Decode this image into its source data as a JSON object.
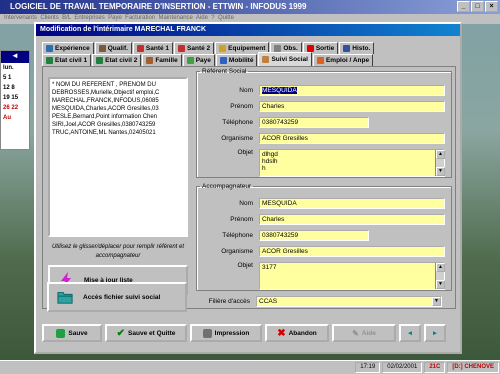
{
  "background_app": {
    "title": "LOGICIEL DE TRAVAIL TEMPORAIRE D'INSERTION - ETTWIN - INFODUS 1999",
    "menu_items": [
      "Intervenants",
      "Clients",
      "B/L",
      "Entreprises",
      "Paye",
      "Facturation",
      "Maintenance",
      "Aide",
      "?",
      "Quitte"
    ],
    "left_panel": {
      "header": "lun.",
      "days": [
        "5",
        "12",
        "19",
        "26"
      ],
      "other": [
        "1",
        "8",
        "15",
        "22"
      ],
      "label": "Au"
    },
    "status": {
      "time": "17:19",
      "date": "02/02/2001",
      "code": "21C",
      "drive": "[D:] CHENOVE"
    }
  },
  "dialog": {
    "title": "Modification de l'intérimaire MARECHAL FRANCK",
    "tabs_row1": [
      {
        "label": "Expérience",
        "icon": "book-icon"
      },
      {
        "label": "Qualif.",
        "icon": "tools-icon"
      },
      {
        "label": "Santé 1",
        "icon": "health-icon"
      },
      {
        "label": "Santé 2",
        "icon": "health-icon"
      },
      {
        "label": "Equipement",
        "icon": "helmet-icon"
      },
      {
        "label": "Obs.",
        "icon": "note-icon"
      },
      {
        "label": "Sortie",
        "icon": "exit-icon"
      },
      {
        "label": "Histo.",
        "icon": "history-icon"
      }
    ],
    "tabs_row2": [
      {
        "label": "Etat civil 1",
        "icon": "id-icon"
      },
      {
        "label": "Etat civil 2",
        "icon": "id-icon"
      },
      {
        "label": "Famille",
        "icon": "family-icon"
      },
      {
        "label": "Paye",
        "icon": "money-icon"
      },
      {
        "label": "Mobilité",
        "icon": "car-icon"
      },
      {
        "label": "Suivi Social",
        "icon": "social-icon",
        "active": true
      },
      {
        "label": "Emploi / Anpe",
        "icon": "job-icon"
      }
    ],
    "list_lines": [
      "* NOM DU REFERENT , PRENOM DU",
      "DEBROSSES,Murielle,Objectif emploi,C",
      "MARECHAL,FRANCK,INFODUS,06085",
      "MESQUIDA,Charles,ACOR Gresilles,03",
      "PESLE,Bernard,Point information Chen",
      "SIRI,Joel,ACOR Gresilles,0380743259",
      "TRUC,ANTOINE,ML Nantes,02405021"
    ],
    "hint": "Utilisez le glisser/déplacer pour remplir référent et accompagnateur",
    "btn_update": "Mise à jour liste",
    "btn_access": "Accès fichier suivi social",
    "referent": {
      "legend": "Référent Social",
      "labels": {
        "nom": "Nom",
        "prenom": "Prénom",
        "tel": "Téléphone",
        "org": "Organisme",
        "objet": "Objet"
      },
      "nom": "MESQUIDA",
      "prenom": "Charles",
      "tel": "0380743259",
      "org": "ACOR Gresilles",
      "objet_lines": [
        "dlhgd",
        "hdslh",
        "h"
      ]
    },
    "accomp": {
      "legend": "Accompagnateur",
      "nom": "MESQUIDA",
      "prenom": "Charles",
      "tel": "0380743259",
      "org": "ACOR Gresilles",
      "objet": "3177"
    },
    "filiere_label": "Filière d'accès",
    "filiere_value": "CCAS",
    "buttons": {
      "save": "Sauve",
      "save_quit": "Sauve et Quitte",
      "print": "Impression",
      "cancel": "Abandon",
      "help": "Aide"
    }
  }
}
